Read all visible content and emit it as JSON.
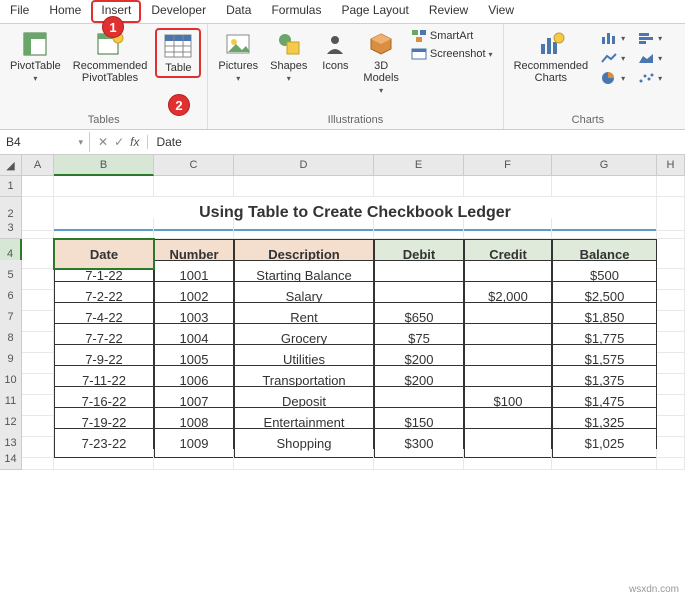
{
  "menu": [
    "File",
    "Home",
    "Insert",
    "Developer",
    "Data",
    "Formulas",
    "Page Layout",
    "Review",
    "View"
  ],
  "activeMenu": "Insert",
  "ribbon": {
    "tables": {
      "label": "Tables",
      "pivot": "PivotTable",
      "recommended": "Recommended\nPivotTables",
      "table": "Table"
    },
    "illustrations": {
      "label": "Illustrations",
      "pictures": "Pictures",
      "shapes": "Shapes",
      "icons": "Icons",
      "models": "3D\nModels",
      "smartart": "SmartArt",
      "screenshot": "Screenshot"
    },
    "charts": {
      "label": "Charts",
      "recommended": "Recommended\nCharts"
    }
  },
  "badges": {
    "1": "1",
    "2": "2"
  },
  "nameBox": "B4",
  "formula": "Date",
  "columns": [
    "A",
    "B",
    "C",
    "D",
    "E",
    "F",
    "G",
    "H"
  ],
  "rowNums": [
    "1",
    "2",
    "3",
    "4",
    "5",
    "6",
    "7",
    "8",
    "9",
    "10",
    "11",
    "12",
    "13",
    "14"
  ],
  "title": "Using Table to Create Checkbook Ledger",
  "headers": [
    "Date",
    "Number",
    "Description",
    "Debit",
    "Credit",
    "Balance"
  ],
  "rows": [
    {
      "date": "7-1-22",
      "num": "1001",
      "desc": "Starting Balance",
      "debit": "",
      "credit": "",
      "bal": "$500"
    },
    {
      "date": "7-2-22",
      "num": "1002",
      "desc": "Salary",
      "debit": "",
      "credit": "$2,000",
      "bal": "$2,500"
    },
    {
      "date": "7-4-22",
      "num": "1003",
      "desc": "Rent",
      "debit": "$650",
      "credit": "",
      "bal": "$1,850"
    },
    {
      "date": "7-7-22",
      "num": "1004",
      "desc": "Grocery",
      "debit": "$75",
      "credit": "",
      "bal": "$1,775"
    },
    {
      "date": "7-9-22",
      "num": "1005",
      "desc": "Utilities",
      "debit": "$200",
      "credit": "",
      "bal": "$1,575"
    },
    {
      "date": "7-11-22",
      "num": "1006",
      "desc": "Transportation",
      "debit": "$200",
      "credit": "",
      "bal": "$1,375"
    },
    {
      "date": "7-16-22",
      "num": "1007",
      "desc": "Deposit",
      "debit": "",
      "credit": "$100",
      "bal": "$1,475"
    },
    {
      "date": "7-19-22",
      "num": "1008",
      "desc": "Entertainment",
      "debit": "$150",
      "credit": "",
      "bal": "$1,325"
    },
    {
      "date": "7-23-22",
      "num": "1009",
      "desc": "Shopping",
      "debit": "$300",
      "credit": "",
      "bal": "$1,025"
    }
  ],
  "watermark": "wsxdn.com"
}
